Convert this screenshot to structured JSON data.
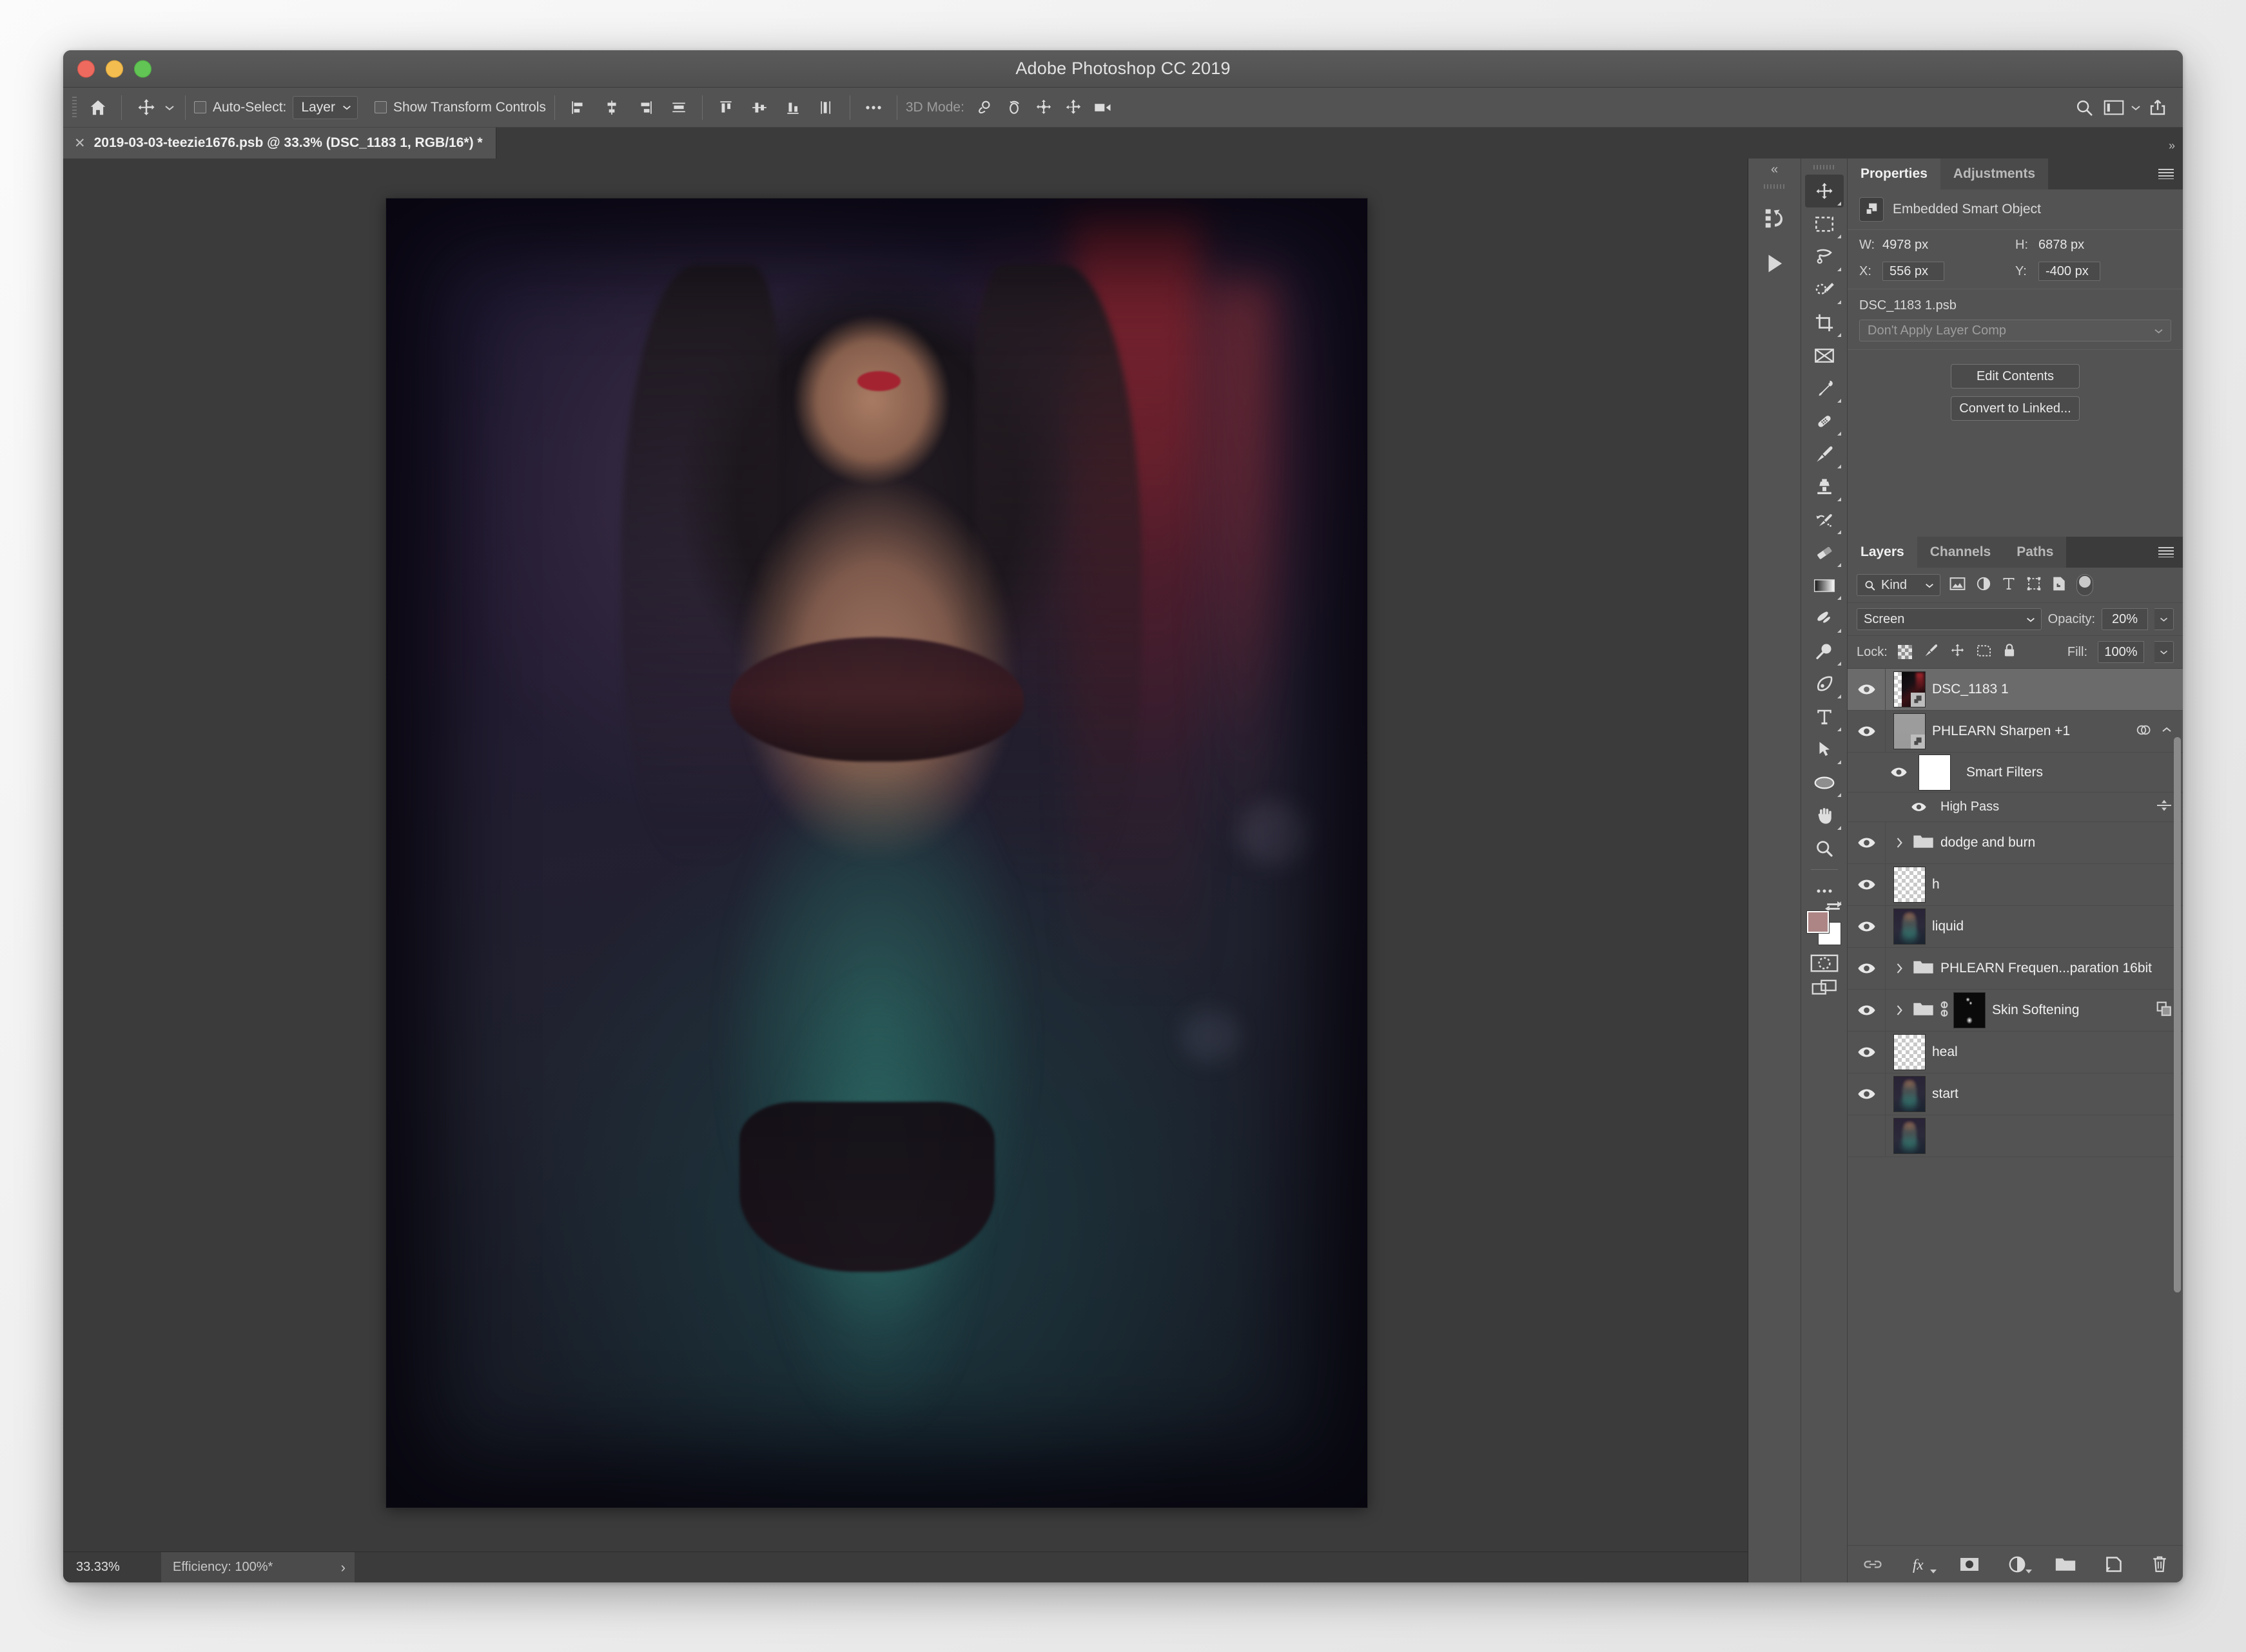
{
  "window": {
    "app_title": "Adobe Photoshop CC 2019",
    "traffic_lights": [
      "close-red",
      "minimize-yellow",
      "zoom-green"
    ]
  },
  "options_bar": {
    "home_icon": "home-icon",
    "active_tool_icon": "move-tool-icon",
    "auto_select_label": "Auto-Select:",
    "auto_select_checked": false,
    "auto_select_value": "Layer",
    "show_transform_label": "Show Transform Controls",
    "show_transform_checked": false,
    "align_icons": [
      "align-left-edges-icon",
      "align-horizontal-centers-icon",
      "align-right-edges-icon",
      "align-top-edges-icon"
    ],
    "distribute_icons": [
      "distribute-top-edges-icon",
      "distribute-vertical-centers-icon",
      "distribute-bottom-edges-icon",
      "distribute-left-edges-icon"
    ],
    "more_icon": "more-options-icon",
    "mode_3d_label": "3D Mode:",
    "mode_3d_icons": [
      "orbit-3d-icon",
      "roll-3d-icon",
      "pan-3d-icon",
      "slide-3d-icon",
      "scale-3d-icon"
    ],
    "right_icons": [
      "search-icon",
      "arrange-documents-icon",
      "chevron-down-icon",
      "share-icon"
    ]
  },
  "document_tab": {
    "close_icon": "close-icon",
    "title": "2019-03-03-teezie1676.psb @ 33.3% (DSC_1183 1, RGB/16*) *"
  },
  "status_bar": {
    "zoom_level": "33.33%",
    "info": "Efficiency: 100%*",
    "expand_icon": "chevron-right-icon"
  },
  "icon_rail": {
    "collapse_icon": "collapse-panels-icon",
    "items": [
      {
        "name": "history-icon",
        "label": "History"
      },
      {
        "name": "actions-play-icon",
        "label": "Actions"
      }
    ]
  },
  "tools": {
    "collapse_icon": "collapse-tools-icon",
    "items": [
      {
        "name": "move-tool-icon",
        "label": "Move Tool",
        "active": true,
        "has_flyout": true
      },
      {
        "name": "rectangular-marquee-tool-icon",
        "label": "Rectangular Marquee Tool",
        "active": false,
        "has_flyout": true
      },
      {
        "name": "lasso-tool-icon",
        "label": "Lasso Tool",
        "active": false,
        "has_flyout": true
      },
      {
        "name": "quick-selection-tool-icon",
        "label": "Quick Selection Tool",
        "active": false,
        "has_flyout": true
      },
      {
        "name": "crop-tool-icon",
        "label": "Crop Tool",
        "active": false,
        "has_flyout": true
      },
      {
        "name": "frame-tool-icon",
        "label": "Frame Tool",
        "active": false,
        "has_flyout": false
      },
      {
        "name": "eyedropper-tool-icon",
        "label": "Eyedropper Tool",
        "active": false,
        "has_flyout": true
      },
      {
        "name": "healing-brush-tool-icon",
        "label": "Spot Healing Brush Tool",
        "active": false,
        "has_flyout": true
      },
      {
        "name": "brush-tool-icon",
        "label": "Brush Tool",
        "active": false,
        "has_flyout": true
      },
      {
        "name": "clone-stamp-tool-icon",
        "label": "Clone Stamp Tool",
        "active": false,
        "has_flyout": true
      },
      {
        "name": "history-brush-tool-icon",
        "label": "History Brush Tool",
        "active": false,
        "has_flyout": true
      },
      {
        "name": "eraser-tool-icon",
        "label": "Eraser Tool",
        "active": false,
        "has_flyout": true
      },
      {
        "name": "gradient-tool-icon",
        "label": "Gradient Tool",
        "active": false,
        "has_flyout": true
      },
      {
        "name": "blur-tool-icon",
        "label": "Blur Tool",
        "active": false,
        "has_flyout": true
      },
      {
        "name": "dodge-tool-icon",
        "label": "Dodge Tool",
        "active": false,
        "has_flyout": true
      },
      {
        "name": "pen-tool-icon",
        "label": "Pen Tool",
        "active": false,
        "has_flyout": true
      },
      {
        "name": "type-tool-icon",
        "label": "Horizontal Type Tool",
        "active": false,
        "has_flyout": true
      },
      {
        "name": "path-selection-tool-icon",
        "label": "Path Selection Tool",
        "active": false,
        "has_flyout": true
      },
      {
        "name": "ellipse-tool-icon",
        "label": "Ellipse Tool",
        "active": false,
        "has_flyout": true
      },
      {
        "name": "hand-tool-icon",
        "label": "Hand Tool",
        "active": false,
        "has_flyout": true
      },
      {
        "name": "zoom-tool-icon",
        "label": "Zoom Tool",
        "active": false,
        "has_flyout": false
      },
      {
        "name": "edit-toolbar-icon",
        "label": "Edit Toolbar",
        "active": false,
        "has_flyout": true
      }
    ],
    "foreground_color": "#ad8585",
    "background_color": "#ffffff",
    "swap_colors_icon": "swap-colors-icon",
    "quick_mask_icon": "quick-mask-mode-icon",
    "screen_mode_icon": "screen-mode-icon"
  },
  "properties_panel": {
    "tabs": [
      {
        "label": "Properties",
        "active": true
      },
      {
        "label": "Adjustments",
        "active": false
      }
    ],
    "menu_icon": "panel-menu-icon",
    "header_icon": "smart-object-icon",
    "header_label": "Embedded Smart Object",
    "width_label": "W:",
    "width_value": "4978 px",
    "height_label": "H:",
    "height_value": "6878 px",
    "x_label": "X:",
    "x_value": "556 px",
    "y_label": "Y:",
    "y_value": "-400 px",
    "filename": "DSC_1183 1.psb",
    "layer_comp_value": "Don't Apply Layer Comp",
    "layer_comp_chevron": "chevron-down-icon",
    "edit_contents_label": "Edit Contents",
    "convert_to_linked_label": "Convert to Linked..."
  },
  "layers_panel": {
    "tabs": [
      {
        "label": "Layers",
        "active": true
      },
      {
        "label": "Channels",
        "active": false
      },
      {
        "label": "Paths",
        "active": false
      }
    ],
    "menu_icon": "panel-menu-icon",
    "filter": {
      "search_icon": "search-icon",
      "kind_label": "Kind",
      "chevron": "chevron-down-icon",
      "type_icons": [
        "filter-pixel-layers-icon",
        "filter-adjustment-layers-icon",
        "filter-type-layers-icon",
        "filter-shape-layers-icon",
        "filter-smart-object-layers-icon"
      ],
      "toggle_icon": "filter-toggle-switch"
    },
    "blend_mode": "Screen",
    "blend_chevron": "chevron-down-icon",
    "opacity_label": "Opacity:",
    "opacity_value": "20%",
    "lock_label": "Lock:",
    "lock_icons": [
      "lock-transparent-pixels-icon",
      "lock-image-pixels-icon",
      "lock-position-icon",
      "lock-artboard-nesting-icon",
      "lock-all-icon"
    ],
    "fill_label": "Fill:",
    "fill_value": "100%",
    "layers": [
      {
        "name": "DSC_1183 1",
        "visible": true,
        "selected": true,
        "thumb": "smart-object-photo",
        "kind": "smart-object",
        "indent": 0,
        "has_disclosure": false
      },
      {
        "name": "PHLEARN Sharpen +1",
        "visible": true,
        "selected": false,
        "thumb": "grey-smart-object",
        "kind": "smart-object",
        "indent": 0,
        "has_disclosure": false,
        "right_icons": [
          "smart-filters-icon",
          "chevron-up-icon"
        ]
      },
      {
        "name": "Smart Filters",
        "visible": true,
        "selected": false,
        "thumb": "white-mask",
        "kind": "smart-filter-group",
        "indent": 1,
        "has_disclosure": false
      },
      {
        "name": "High Pass",
        "visible": true,
        "selected": false,
        "kind": "smart-filter",
        "indent": 2,
        "has_disclosure": false,
        "right_icons": [
          "blending-options-icon"
        ]
      },
      {
        "name": "dodge and burn",
        "visible": true,
        "selected": false,
        "kind": "group",
        "indent": 0,
        "has_disclosure": true
      },
      {
        "name": "h",
        "visible": true,
        "selected": false,
        "thumb": "transparent",
        "kind": "pixel",
        "indent": 0,
        "has_disclosure": false
      },
      {
        "name": "liquid",
        "visible": true,
        "selected": false,
        "thumb": "photo",
        "kind": "pixel",
        "indent": 0,
        "has_disclosure": false
      },
      {
        "name": "PHLEARN Frequen...paration 16bit",
        "visible": true,
        "selected": false,
        "kind": "group",
        "indent": 0,
        "has_disclosure": true
      },
      {
        "name": "Skin Softening",
        "visible": true,
        "selected": false,
        "thumb": "black-mask",
        "kind": "group",
        "indent": 0,
        "has_disclosure": true,
        "has_link": true,
        "right_icons": [
          "clipped-layers-icon"
        ]
      },
      {
        "name": "heal",
        "visible": true,
        "selected": false,
        "thumb": "transparent",
        "kind": "pixel",
        "indent": 0,
        "has_disclosure": false
      },
      {
        "name": "start",
        "visible": true,
        "selected": false,
        "thumb": "photo",
        "kind": "pixel",
        "indent": 0,
        "has_disclosure": false
      }
    ],
    "footer_icons": [
      "link-layers-icon",
      "layer-style-fx-icon",
      "add-layer-mask-icon",
      "new-adjustment-layer-icon",
      "new-group-icon",
      "new-layer-icon",
      "delete-layer-icon"
    ]
  },
  "canvas": {
    "description": "portrait photograph on artboard"
  }
}
